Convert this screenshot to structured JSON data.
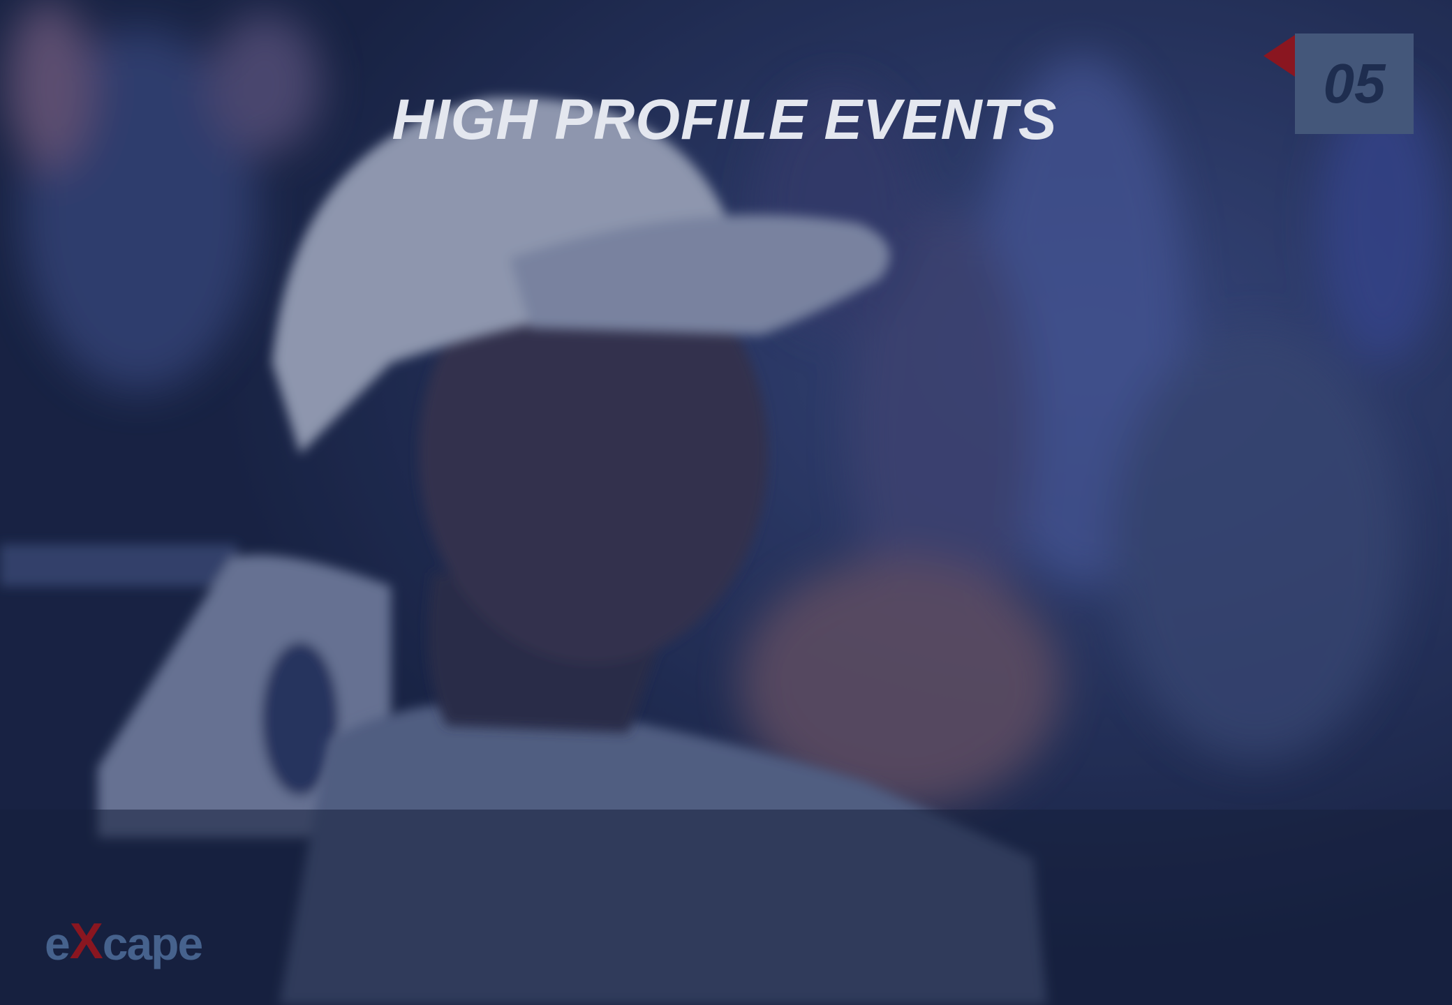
{
  "slide": {
    "title": "HIGH PROFILE EVENTS",
    "page_number": "05"
  },
  "logo": {
    "prefix": "e",
    "x": "X",
    "suffix": "cape"
  },
  "colors": {
    "overlay": "#1b2747",
    "title": "#e4e7ef",
    "badge": "#44577a",
    "accent_red": "#8a1620",
    "logo_blue": "#46628d"
  }
}
